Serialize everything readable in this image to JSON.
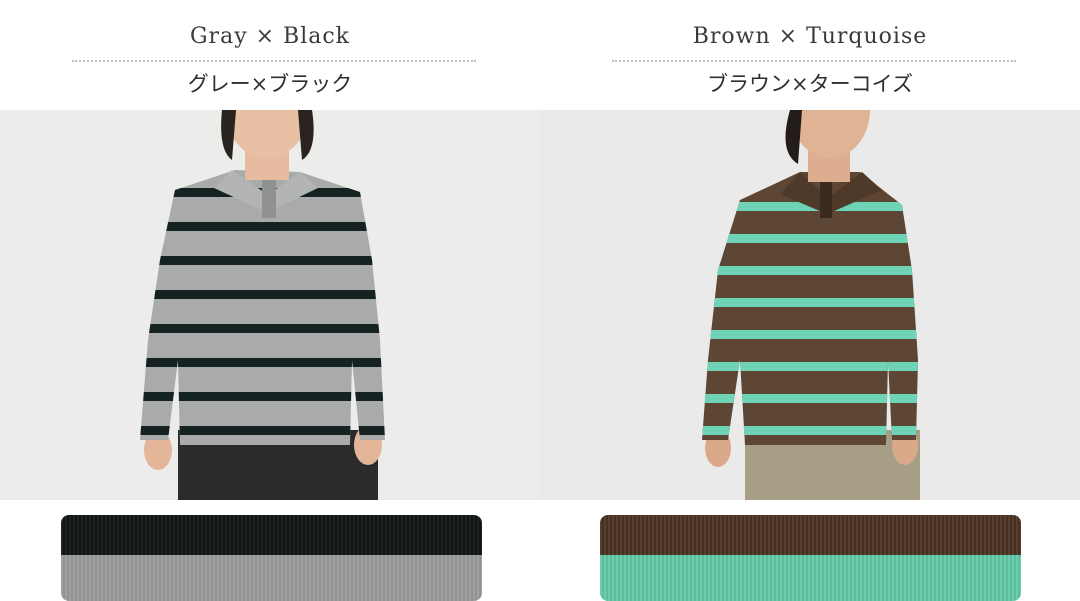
{
  "variants": [
    {
      "name_en": "Gray × Black",
      "name_ja": "グレー×ブラック",
      "colors": {
        "body": "#a9abaa",
        "stripe": "#142222",
        "pants": "#2b2b2d",
        "background": "#ececea",
        "swatch_top": "#111515",
        "swatch_bottom": "#9a9c9b"
      }
    },
    {
      "name_en": "Brown × Turquoise",
      "name_ja": "ブラウン×ターコイズ",
      "colors": {
        "body": "#5e4634",
        "stripe": "#6fd4b6",
        "pants": "#a69f86",
        "background": "#eaeaea",
        "swatch_top": "#4b3322",
        "swatch_bottom": "#63c9a9"
      }
    }
  ]
}
